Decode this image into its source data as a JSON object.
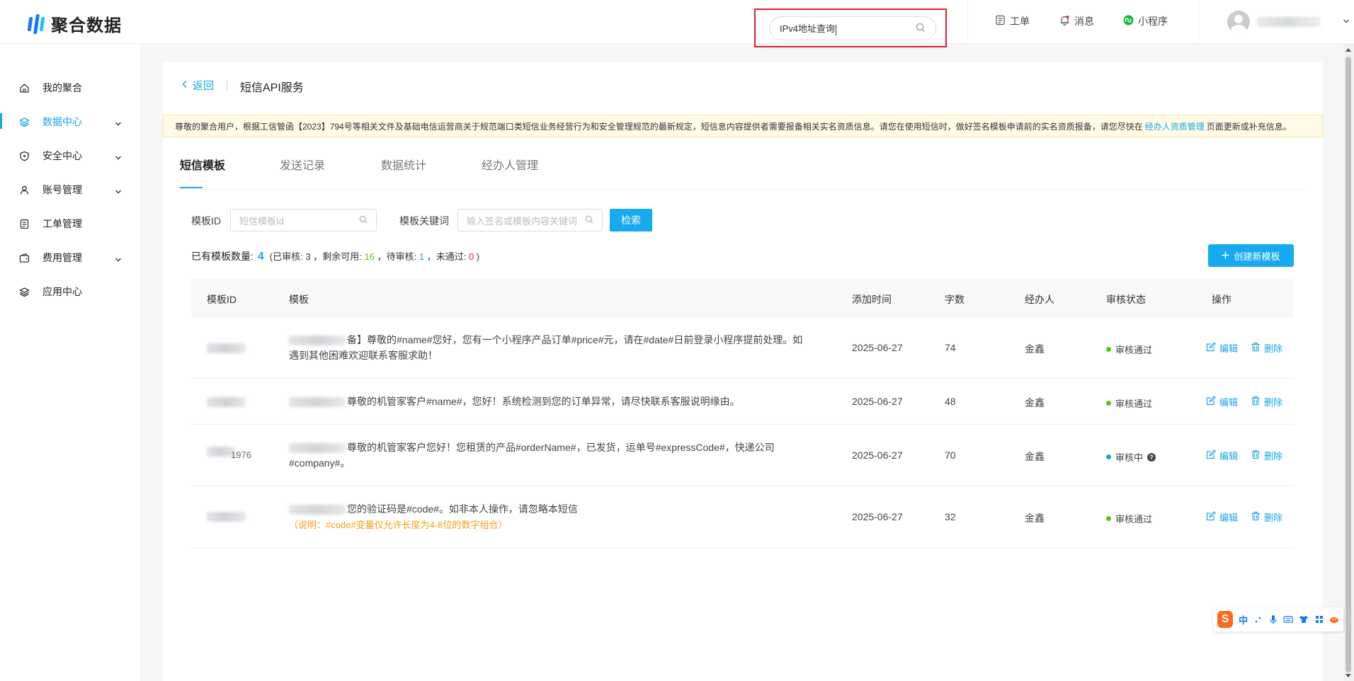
{
  "brand": {
    "logo_text": "聚合数据"
  },
  "top_search": {
    "value": "IPv4地址查询"
  },
  "top_nav": {
    "ticket": "工单",
    "messages": "消息",
    "miniprogram": "小程序"
  },
  "sidebar": {
    "items": [
      {
        "label": "我的聚合",
        "icon": "home-icon",
        "expandable": false,
        "active": false
      },
      {
        "label": "数据中心",
        "icon": "layers-icon",
        "expandable": true,
        "active": true
      },
      {
        "label": "安全中心",
        "icon": "shield-icon",
        "expandable": true,
        "active": false
      },
      {
        "label": "账号管理",
        "icon": "user-icon",
        "expandable": true,
        "active": false
      },
      {
        "label": "工单管理",
        "icon": "document-icon",
        "expandable": false,
        "active": false
      },
      {
        "label": "费用管理",
        "icon": "wallet-icon",
        "expandable": true,
        "active": false
      },
      {
        "label": "应用中心",
        "icon": "stack-icon",
        "expandable": false,
        "active": false
      }
    ]
  },
  "header": {
    "back_label": "返回",
    "title": "短信API服务"
  },
  "notice": {
    "text_before": "尊敬的聚合用户，根据工信管函【2023】794号等相关文件及基础电信运营商关于规范端口类短信业务经营行为和安全管理规范的最新规定，短信息内容提供者需要报备相关实名资质信息。请您在使用短信时，做好签名模板申请前的实名资质报备，请您尽快在",
    "link": "经办人资质管理",
    "text_after": "页面更新或补充信息。"
  },
  "tabs": [
    {
      "label": "短信模板",
      "active": true
    },
    {
      "label": "发送记录",
      "active": false
    },
    {
      "label": "数据统计",
      "active": false
    },
    {
      "label": "经办人管理",
      "active": false
    }
  ],
  "filters": {
    "template_id_label": "模板ID",
    "template_id_placeholder": "短信模板Id",
    "keyword_label": "模板关键词",
    "keyword_placeholder": "输入签名或模板内容关键词",
    "search_button": "检索"
  },
  "summary": {
    "prefix": "已有模板数量:",
    "total": "4",
    "open": "(已审核:",
    "approved": "3",
    "remaining_label": "，剩余可用:",
    "remaining": "16",
    "pending_label": "，待审核:",
    "pending": "1",
    "rejected_label": "，未通过:",
    "rejected": "0",
    "close": ")"
  },
  "create_button": "创建新模板",
  "table": {
    "columns": [
      "模板ID",
      "模板",
      "添加时间",
      "字数",
      "经办人",
      "审核状态",
      "操作"
    ],
    "rows": [
      {
        "id_visible": "",
        "signature_suffix": "备】",
        "content": "尊敬的#name#您好，您有一个小程序产品订单#price#元，请在#date#日前登录小程序提前处理。如遇到其他困难欢迎联系客服求助！",
        "hint": "",
        "date": "2025-06-27",
        "chars": "74",
        "handler": "金鑫",
        "status": "审核通过",
        "status_color": "#52c41a",
        "help": false
      },
      {
        "id_visible": "",
        "signature_suffix": "",
        "content": "尊敬的机管家客户#name#，您好！系统检测到您的订单异常，请尽快联系客服说明缘由。",
        "hint": "",
        "date": "2025-06-27",
        "chars": "48",
        "handler": "金鑫",
        "status": "审核通过",
        "status_color": "#52c41a",
        "help": false
      },
      {
        "id_visible": "1976",
        "signature_suffix": "",
        "content": "尊敬的机管家客户您好！您租赁的产品#orderName#，已发货，运单号#expressCode#，快递公司#company#。",
        "hint": "",
        "date": "2025-06-27",
        "chars": "70",
        "handler": "金鑫",
        "status": "审核中",
        "status_color": "#1aa5e8",
        "help": true
      },
      {
        "id_visible": "",
        "signature_suffix": "",
        "content": "您的验证码是#code#。如非本人操作，请忽略本短信",
        "hint": "（说明：#code#变量仅允许长度为4-8位的数字组合）",
        "date": "2025-06-27",
        "chars": "32",
        "handler": "金鑫",
        "status": "审核通过",
        "status_color": "#52c41a",
        "help": false
      }
    ],
    "edit_label": "编辑",
    "delete_label": "删除"
  },
  "ime": {
    "lang": "中"
  },
  "colors": {
    "accent": "#1aa5e8",
    "primary_button": "#16aaf0",
    "notice_bg": "#fffbe6",
    "success": "#52c41a",
    "danger": "#f5222d"
  }
}
